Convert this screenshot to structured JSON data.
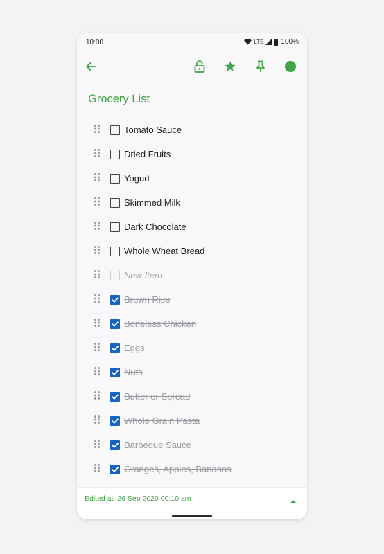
{
  "status_bar": {
    "time": "10:00",
    "network": "LTE",
    "battery": "100%"
  },
  "toolbar": {
    "icons": [
      "back-arrow-icon",
      "unlock-icon",
      "star-icon",
      "pin-icon",
      "color-dot-icon"
    ]
  },
  "note": {
    "title": "Grocery List",
    "accent_color": "#43a447",
    "check_color": "#1565c0"
  },
  "items": [
    {
      "label": "Tomato Sauce",
      "state": "unchecked"
    },
    {
      "label": "Dried Fruits",
      "state": "unchecked"
    },
    {
      "label": "Yogurt",
      "state": "unchecked"
    },
    {
      "label": "Skimmed Milk",
      "state": "unchecked"
    },
    {
      "label": "Dark Chocolate",
      "state": "unchecked"
    },
    {
      "label": "Whole Wheat Bread",
      "state": "unchecked"
    },
    {
      "label": "New Item",
      "state": "placeholder"
    },
    {
      "label": "Brown Rice",
      "state": "checked"
    },
    {
      "label": "Boneless Chicken",
      "state": "checked"
    },
    {
      "label": "Eggs",
      "state": "checked"
    },
    {
      "label": "Nuts",
      "state": "checked"
    },
    {
      "label": "Butter or Spread",
      "state": "checked"
    },
    {
      "label": "Whole Grain Pasta",
      "state": "checked"
    },
    {
      "label": "Barbeque Sauce",
      "state": "checked"
    },
    {
      "label": "Oranges, Apples, Bananas",
      "state": "checked"
    }
  ],
  "footer": {
    "edited_text": "Edited at: 26 Sep 2020 00:10 am"
  }
}
